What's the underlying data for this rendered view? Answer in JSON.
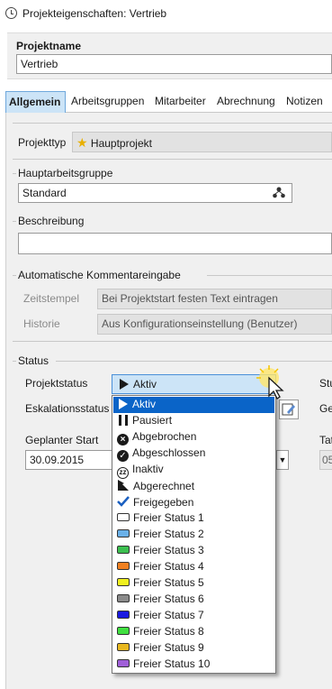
{
  "window": {
    "title": "Projekteigenschaften: Vertrieb"
  },
  "project_name": {
    "label": "Projektname",
    "value": "Vertrieb"
  },
  "tabs": [
    "Allgemein",
    "Arbeitsgruppen",
    "Mitarbeiter",
    "Abrechnung",
    "Notizen"
  ],
  "general": {
    "project_type": {
      "label": "Projekttyp",
      "value": "Hauptprojekt"
    },
    "main_group": {
      "label": "Hauptarbeitsgruppe",
      "value": "Standard"
    },
    "description": {
      "label": "Beschreibung",
      "value": ""
    },
    "auto_comment": {
      "label": "Automatische Kommentareingabe",
      "timestamp": {
        "label": "Zeitstempel",
        "value": "Bei Projektstart festen Text eintragen"
      },
      "history": {
        "label": "Historie",
        "value": "Aus Konfigurationseinstellung (Benutzer)"
      }
    }
  },
  "status": {
    "label": "Status",
    "project_status_label": "Projektstatus",
    "escalation_label": "Eskalationsstatus",
    "planned_start_label": "Geplanter Start",
    "planned_start_value": "30.09.2015",
    "right_col": {
      "row1": "Stu",
      "row2": "Ge",
      "row3": "Tat",
      "row4": "05"
    },
    "dropdown": {
      "selected": "Aktiv",
      "items": [
        {
          "label": "Aktiv",
          "icon": "play-icon",
          "selected": true
        },
        {
          "label": "Pausiert",
          "icon": "pause-icon"
        },
        {
          "label": "Abgebrochen",
          "icon": "cancel-circle-icon"
        },
        {
          "label": "Abgeschlossen",
          "icon": "check-circle-icon"
        },
        {
          "label": "Inaktiv",
          "icon": "inactive-icon"
        },
        {
          "label": "Abgerechnet",
          "icon": "billed-flag-icon"
        },
        {
          "label": "Freigegeben",
          "icon": "checkmark-icon"
        },
        {
          "label": "Freier Status 1",
          "color": "#ffffff"
        },
        {
          "label": "Freier Status 2",
          "color": "#6ab0e8"
        },
        {
          "label": "Freier Status 3",
          "color": "#3cc050"
        },
        {
          "label": "Freier Status 4",
          "color": "#f08020"
        },
        {
          "label": "Freier Status 5",
          "color": "#f0f020"
        },
        {
          "label": "Freier Status 6",
          "color": "#8a8a8a"
        },
        {
          "label": "Freier Status 7",
          "color": "#1a1ae0"
        },
        {
          "label": "Freier Status 8",
          "color": "#40e040"
        },
        {
          "label": "Freier Status 9",
          "color": "#e8b820"
        },
        {
          "label": "Freier Status 10",
          "color": "#a060d8"
        }
      ]
    }
  }
}
